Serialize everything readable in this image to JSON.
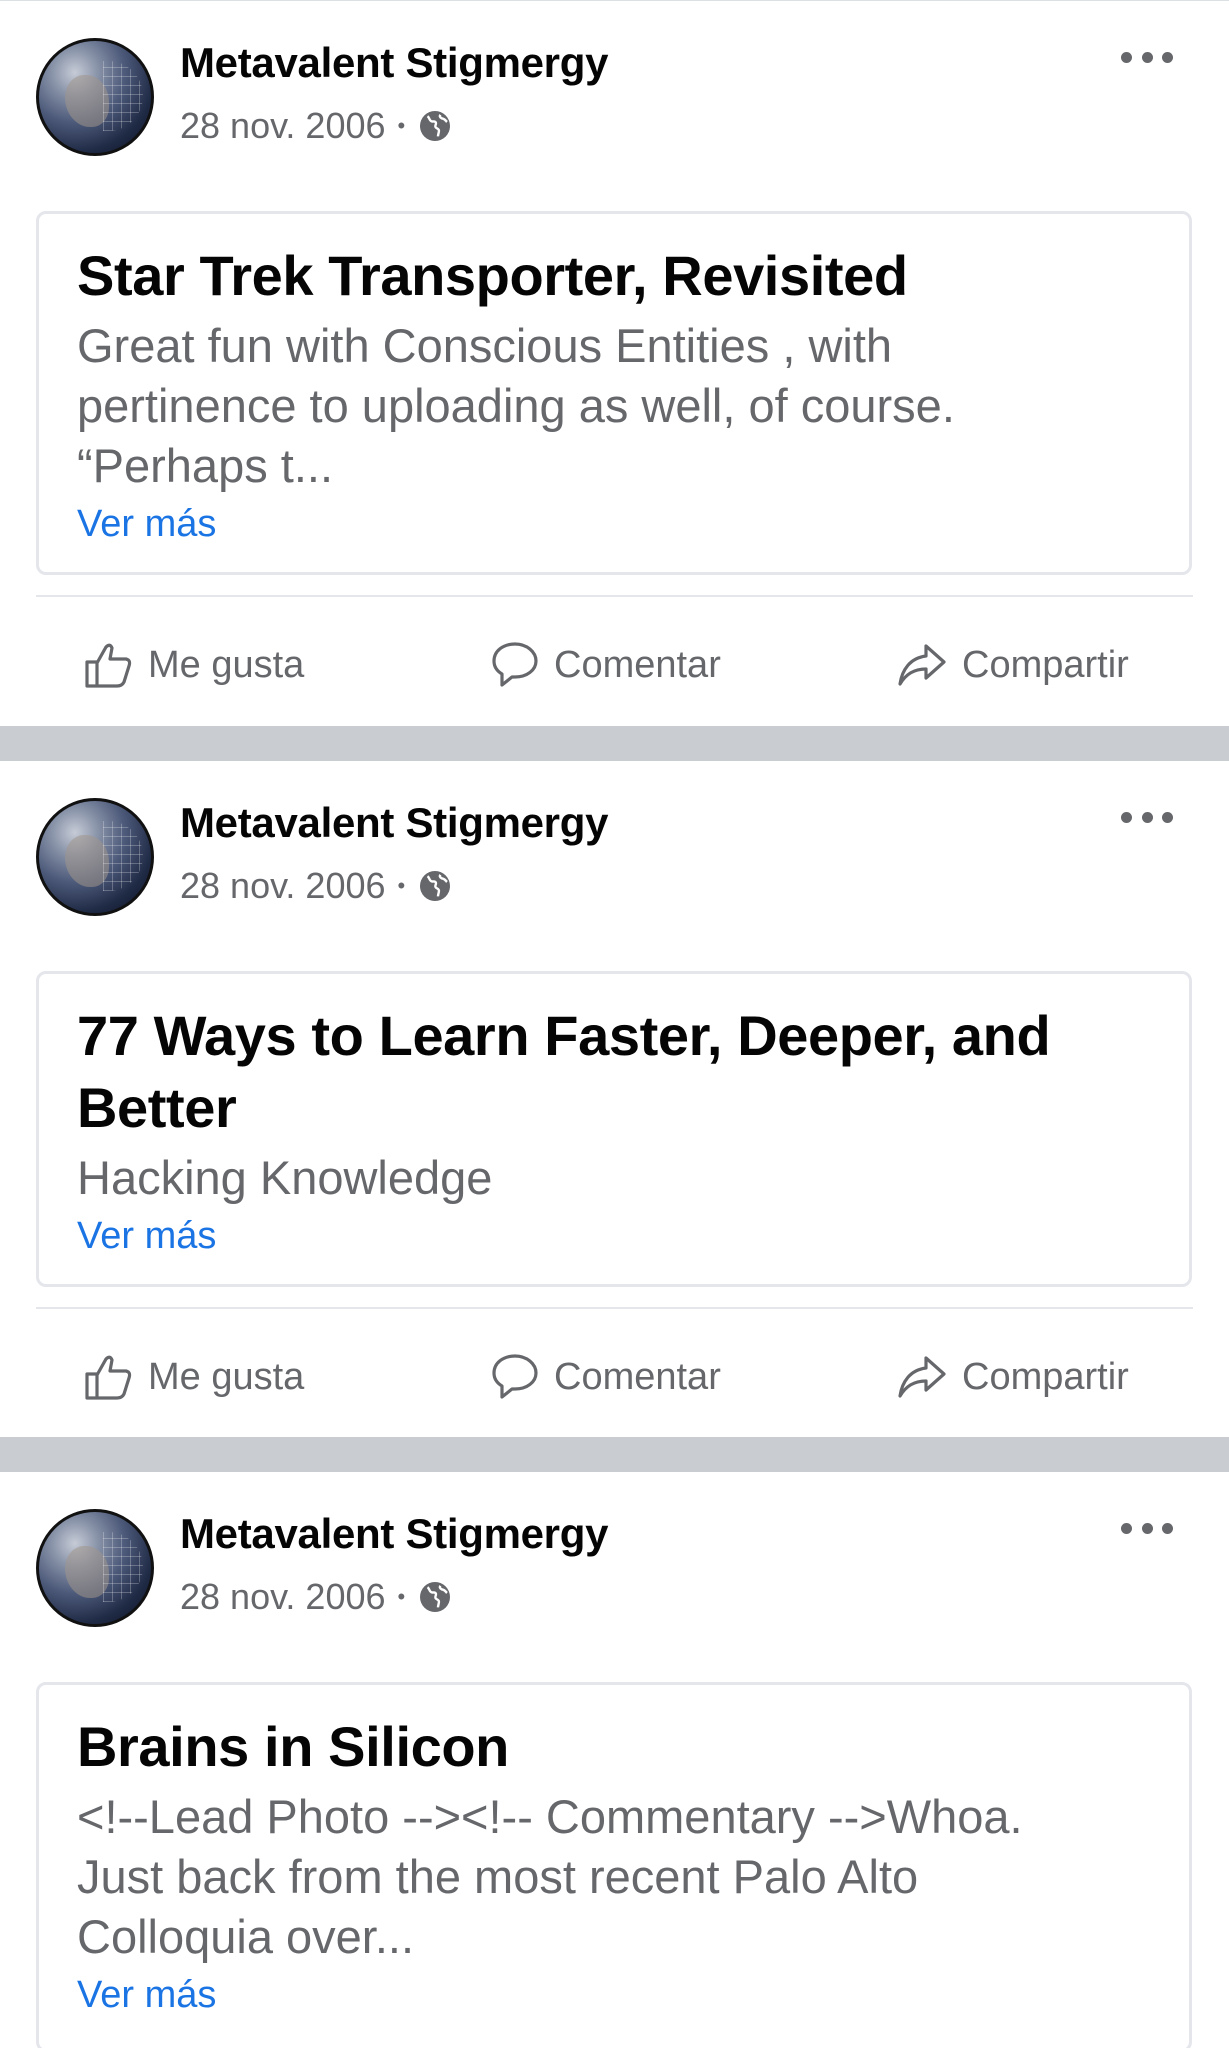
{
  "posts": [
    {
      "author": "Metavalent Stigmergy",
      "date": "28 nov. 2006",
      "separator": "•",
      "card": {
        "title": "Star Trek Transporter, Revisited",
        "text_lines": [
          "Great fun with  Conscious Entities , with",
          "pertinence to  uploading  as well, of course.",
          "“Perhaps t..."
        ],
        "see_more": "Ver más"
      },
      "actions": {
        "like": "Me gusta",
        "comment": "Comentar",
        "share": "Compartir"
      }
    },
    {
      "author": "Metavalent Stigmergy",
      "date": "28 nov. 2006",
      "separator": "•",
      "card": {
        "title_lines": [
          "77 Ways to Learn Faster, Deeper, and",
          "Better"
        ],
        "text_lines": [
          "Hacking Knowledge"
        ],
        "see_more": "Ver más"
      },
      "actions": {
        "like": "Me gusta",
        "comment": "Comentar",
        "share": "Compartir"
      }
    },
    {
      "author": "Metavalent Stigmergy",
      "date": "28 nov. 2006",
      "separator": "•",
      "card": {
        "title": "Brains in Silicon",
        "text_lines": [
          "<!--Lead Photo --><!-- Commentary -->Whoa.",
          "Just back from the most recent  Palo Alto",
          "Colloquia  over..."
        ],
        "see_more": "Ver más"
      },
      "actions": {
        "like": "Me gusta",
        "comment": "Comentar",
        "share": "Compartir"
      }
    }
  ],
  "icons": {
    "avatar": "earth-globe-avatar",
    "audience": "globe-icon",
    "more": "more-options-icon",
    "like": "thumbs-up-icon",
    "comment": "comment-bubble-icon",
    "share": "share-arrow-icon"
  },
  "colors": {
    "link": "#1b74e4",
    "secondary_text": "#65676b",
    "separator": "#c9ccd1"
  }
}
